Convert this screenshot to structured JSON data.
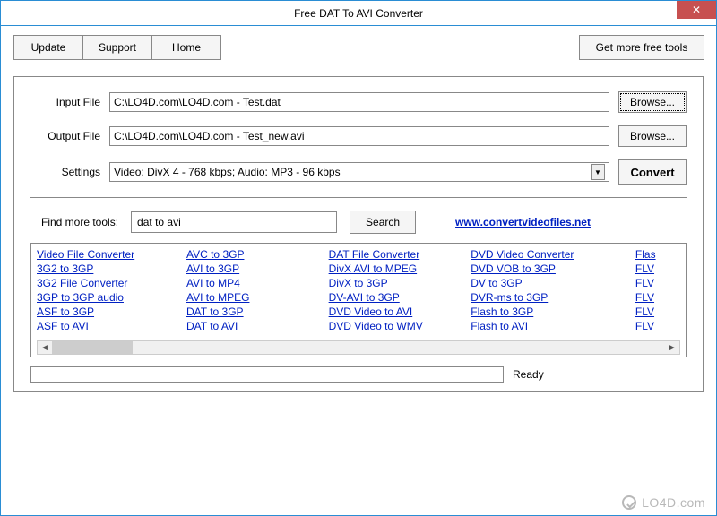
{
  "window": {
    "title": "Free DAT To AVI Converter"
  },
  "titlebar": {
    "close": "✕"
  },
  "toolbar": {
    "update": "Update",
    "support": "Support",
    "home": "Home",
    "get_more": "Get more free tools"
  },
  "form": {
    "input_label": "Input File",
    "input_value": "C:\\LO4D.com\\LO4D.com - Test.dat",
    "output_label": "Output File",
    "output_value": "C:\\LO4D.com\\LO4D.com - Test_new.avi",
    "settings_label": "Settings",
    "settings_value": "Video: DivX 4 - 768 kbps; Audio: MP3 - 96 kbps",
    "browse": "Browse...",
    "convert": "Convert"
  },
  "find": {
    "label": "Find more tools:",
    "value": "dat to avi",
    "search": "Search",
    "site": "www.convertvideofiles.net"
  },
  "tools": {
    "col0": [
      "Video File Converter",
      "3G2 to 3GP",
      "3G2 File Converter",
      "3GP to 3GP audio",
      "ASF to 3GP",
      "ASF to AVI"
    ],
    "col1": [
      "AVC to 3GP",
      "AVI to 3GP",
      "AVI to MP4",
      "AVI to MPEG",
      "DAT to 3GP",
      "DAT to AVI"
    ],
    "col2": [
      "DAT File Converter",
      "DivX AVI to MPEG",
      "DivX to 3GP",
      "DV-AVI to 3GP",
      "DVD Video to AVI",
      "DVD Video to WMV"
    ],
    "col3": [
      "DVD Video Converter",
      "DVD VOB to 3GP",
      "DV to 3GP",
      "DVR-ms to 3GP",
      "Flash to 3GP",
      "Flash to AVI"
    ],
    "col4": [
      "Flas",
      "FLV",
      "FLV",
      "FLV",
      "FLV",
      "FLV"
    ]
  },
  "status": {
    "text": "Ready"
  },
  "watermark": {
    "text": "LO4D.com"
  }
}
